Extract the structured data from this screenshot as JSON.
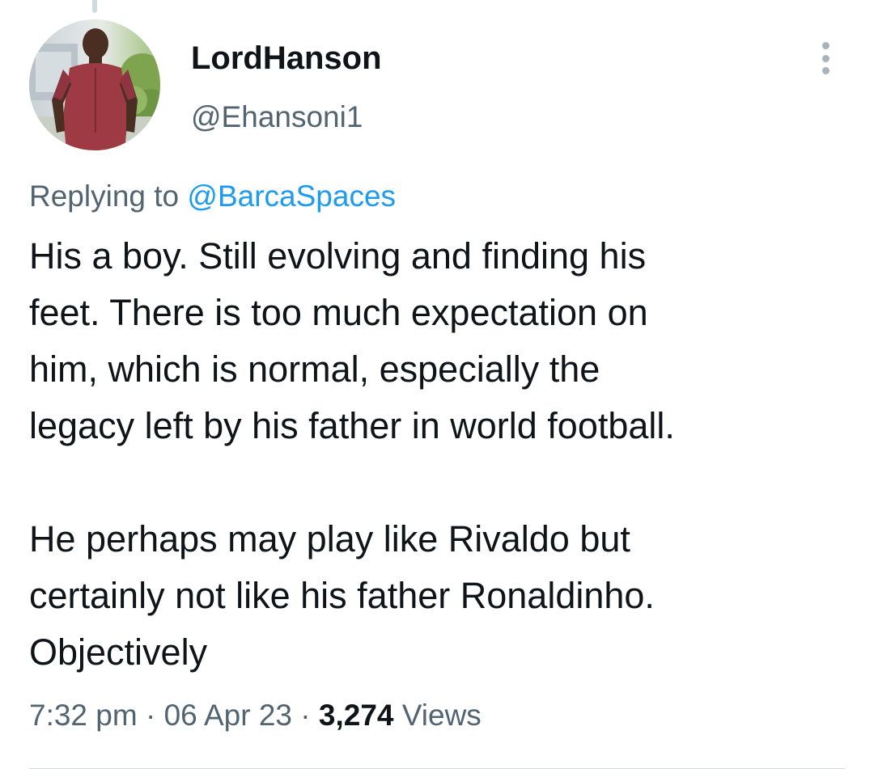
{
  "author": {
    "display_name": "LordHanson",
    "handle": "@Ehansoni1",
    "avatar_icon": "profile-photo-man-in-red-shirt"
  },
  "reply": {
    "prefix": "Replying to",
    "mention": "@BarcaSpaces"
  },
  "tweet": {
    "lines_para1": [
      "His a boy. Still evolving and finding his",
      "feet. There is too much expectation on",
      "him, which is normal, especially the",
      "legacy left by his father in world football."
    ],
    "lines_para2": [
      "He perhaps may play like Rivaldo but",
      "certainly not like his father Ronaldinho.",
      "Objectively"
    ]
  },
  "meta": {
    "time": "7:32 pm",
    "separator": "·",
    "date": "06 Apr 23",
    "views_count": "3,274",
    "views_label": "Views"
  },
  "more_icon": "more-vertical-icon",
  "colors": {
    "text": "#0f1419",
    "secondary": "#536471",
    "link": "#1d9bf0",
    "divider": "#cfd9de"
  }
}
